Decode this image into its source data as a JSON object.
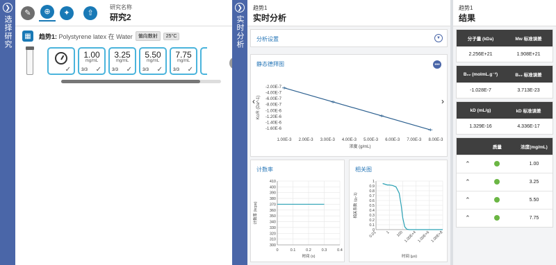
{
  "left_tab": {
    "label": "选择研究"
  },
  "study": {
    "label": "研究名称",
    "name": "研究2"
  },
  "toolbar": {
    "edit_icon": "pencil-icon",
    "zoom_icon": "zoom-icon",
    "analyze_icon": "analyze-icon",
    "upload_icon": "upload-icon"
  },
  "sample": {
    "title_bold": "趋势1:",
    "title_text": "Polystyrene latex 在 Water",
    "badge1": "偏向散射",
    "badge2": "25°C"
  },
  "concentrations": [
    {
      "value": "1.00",
      "unit": "mg/mL",
      "fraction": "3/3"
    },
    {
      "value": "3.25",
      "unit": "mg/mL",
      "fraction": "3/3"
    },
    {
      "value": "5.50",
      "unit": "mg/mL",
      "fraction": "3/3"
    },
    {
      "value": "7.75",
      "unit": "mg/mL",
      "fraction": "3/3"
    }
  ],
  "analysis_tab": {
    "label": "实时分析"
  },
  "analysis": {
    "header_small": "趋势1",
    "header_title": "实时分析",
    "settings_label": "分析设置",
    "debye_title": "静态德拜图",
    "count_title": "计数率",
    "corr_title": "相关图"
  },
  "results": {
    "header_small": "趋势1",
    "header_title": "结果",
    "table1": {
      "h1": "分子量 (kDa)",
      "h2": "Mw 标准误差",
      "v1": "2.256E+21",
      "v2": "1.908E+21"
    },
    "table2": {
      "h1": "B₂₂ (molmL.g⁻²)",
      "h2": "B₂₂ 标准误差",
      "v1": "-1.028E-7",
      "v2": "3.713E-23"
    },
    "table3": {
      "h1": "kD (mL/g)",
      "h2": "kD 标准误差",
      "v1": "1.329E-16",
      "v2": "4.336E-17"
    },
    "table4": {
      "h1": "质量",
      "h2": "浓度(mg/mL)",
      "rows": [
        {
          "conc": "1.00"
        },
        {
          "conc": "3.25"
        },
        {
          "conc": "5.50"
        },
        {
          "conc": "7.75"
        }
      ]
    }
  },
  "chart_data": [
    {
      "type": "scatter",
      "title": "静态德拜图",
      "xlabel": "浓度 (g/mL)",
      "ylabel": "Kc/R (Da^-1)",
      "x_ticks": [
        "1.00E-3",
        "2.00E-3",
        "3.00E-3",
        "4.00E-3",
        "5.00E-3",
        "6.00E-3",
        "7.00E-3",
        "8.00E-3"
      ],
      "y_ticks": [
        "-2.00E-7",
        "-4.00E-7",
        "-6.00E-7",
        "-8.00E-7",
        "-1.00E-6",
        "-1.20E-6",
        "-1.40E-6",
        "-1.60E-6"
      ],
      "xlim": [
        0.001,
        0.008
      ],
      "ylim": [
        -1.7e-06,
        -2e-07
      ],
      "x": [
        0.001,
        0.00325,
        0.0055,
        0.00775
      ],
      "y": [
        -2.4e-07,
        -7.1e-07,
        -1.18e-06,
        -1.65e-06
      ],
      "fit_line": true
    },
    {
      "type": "line",
      "title": "计数率",
      "xlabel": "时间 (s)",
      "ylabel": "计数率 (kcps)",
      "x_ticks": [
        "0",
        "0.1",
        "0.2",
        "0.3",
        "0.4"
      ],
      "y_ticks": [
        "300",
        "310",
        "320",
        "330",
        "340",
        "350",
        "360",
        "370",
        "380",
        "390",
        "400",
        "410"
      ],
      "xlim": [
        0,
        0.4
      ],
      "ylim": [
        300,
        410
      ],
      "x": [
        0,
        0.3
      ],
      "y": [
        370,
        370
      ]
    },
    {
      "type": "line",
      "title": "相关图",
      "xlabel": "时间 (μs)",
      "ylabel": "相关系数 (g₂-1)",
      "x_ticks": [
        "0.01",
        "1",
        "100",
        "1.00E+4",
        "1.00E+6",
        "1.00E+8"
      ],
      "y_ticks": [
        "0",
        "0.1",
        "0.2",
        "0.3",
        "0.4",
        "0.5",
        "0.6",
        "0.7",
        "0.8",
        "0.9",
        "1"
      ],
      "x_scale": "log",
      "xlim": [
        0.01,
        100000000.0
      ],
      "ylim": [
        0,
        1
      ],
      "x": [
        0.1,
        0.5,
        1,
        3,
        10,
        30,
        60,
        100,
        200,
        400,
        1000,
        10000.0,
        100000000.0
      ],
      "y": [
        0.95,
        0.92,
        0.92,
        0.91,
        0.88,
        0.75,
        0.5,
        0.25,
        0.06,
        0.01,
        0.0,
        0.0,
        0.0
      ]
    }
  ]
}
